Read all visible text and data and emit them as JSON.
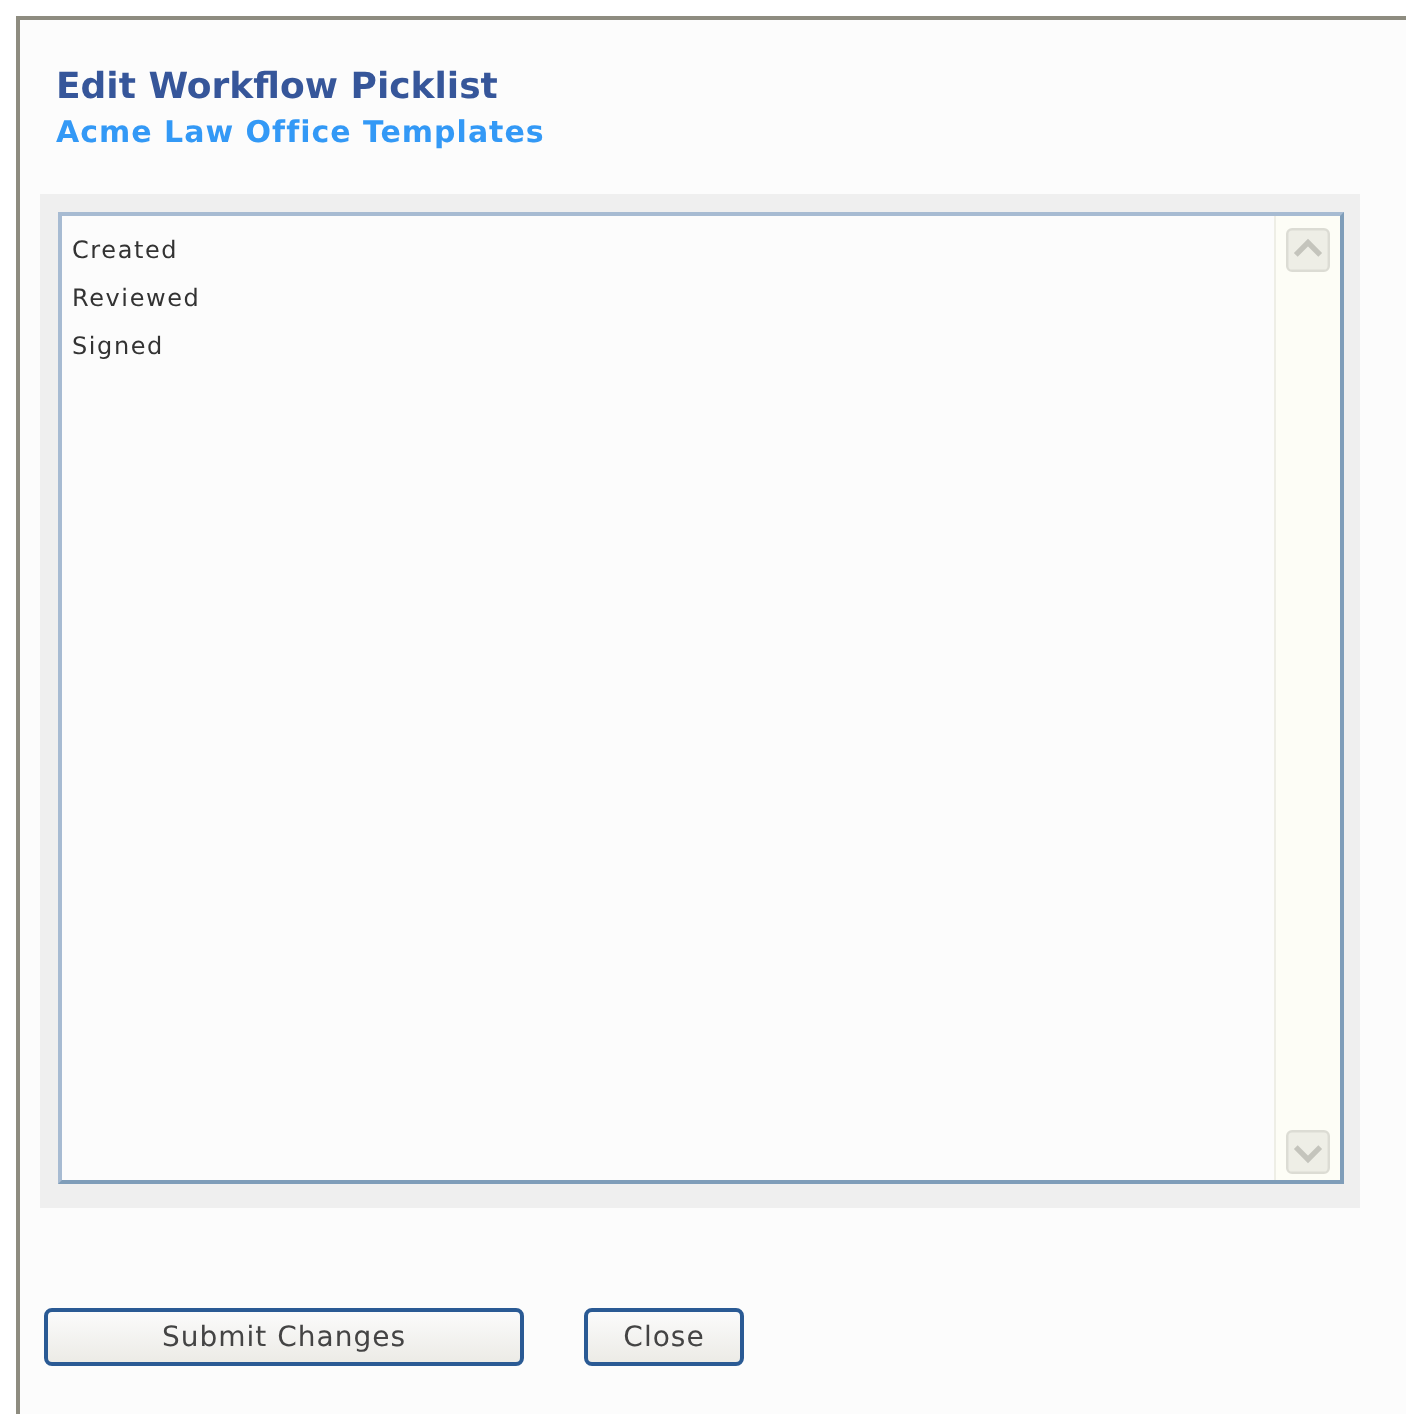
{
  "title": "Edit Workflow Picklist",
  "subtitle": "Acme Law Office Templates",
  "picklist": {
    "lines": [
      "Created",
      "Reviewed",
      "Signed"
    ]
  },
  "buttons": [
    {
      "label": "Submit Changes",
      "kind": "wide"
    },
    {
      "label": "Close",
      "kind": "narrow"
    }
  ]
}
